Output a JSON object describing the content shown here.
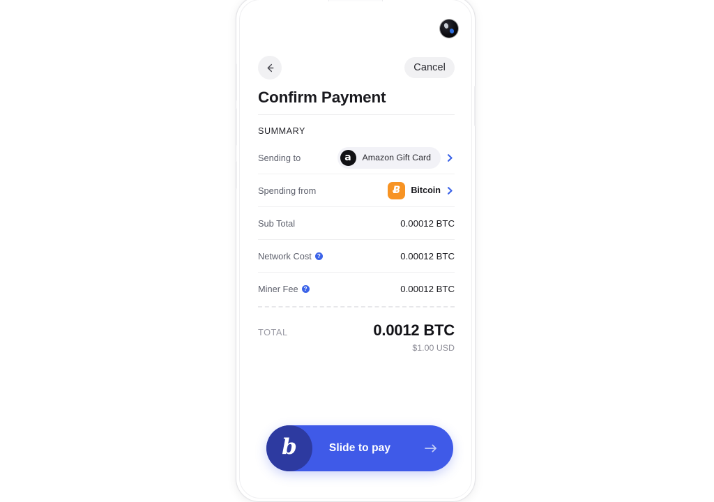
{
  "device": {
    "name": "android-phone-mockup",
    "camera_icon": "front-camera-punch-hole",
    "earpiece_icon": "earpiece-speaker"
  },
  "topbar": {
    "back_icon": "arrow-left-icon",
    "cancel_label": "Cancel"
  },
  "header": {
    "title": "Confirm Payment",
    "section_label": "SUMMARY"
  },
  "rows": [
    {
      "label": "Sending to",
      "type": "merchant",
      "merchant_name": "Amazon Gift Card",
      "merchant_logo_glyph": "a",
      "chevron_icon": "chevron-right-icon"
    },
    {
      "label": "Spending from",
      "type": "asset",
      "asset_name": "Bitcoin",
      "asset_logo_glyph": "Ƀ",
      "chevron_icon": "chevron-right-icon"
    },
    {
      "label": "Sub Total",
      "type": "amount",
      "value": "0.00012 BTC",
      "help": false
    },
    {
      "label": "Network Cost",
      "type": "amount",
      "value": "0.00012 BTC",
      "help": true,
      "help_glyph": "?"
    },
    {
      "label": "Miner Fee",
      "type": "amount",
      "value": "0.00012 BTC",
      "help": true,
      "help_glyph": "?"
    }
  ],
  "total": {
    "label": "TOTAL",
    "amount": "0.0012 BTC",
    "fiat": "$1.00 USD"
  },
  "slider": {
    "text": "Slide to pay",
    "handle_glyph": "b",
    "arrow_icon": "arrow-right-icon"
  },
  "colors": {
    "accent_blue": "#3b63e8",
    "slider_track": "#3f5ae8",
    "slider_handle": "#2d3aa0",
    "bitcoin_orange": "#f79323",
    "amazon_black": "#111114",
    "pill_bg": "#f2f2f7",
    "label_gray": "#5c5f6b",
    "total_label_gray": "#9a9aa4"
  }
}
